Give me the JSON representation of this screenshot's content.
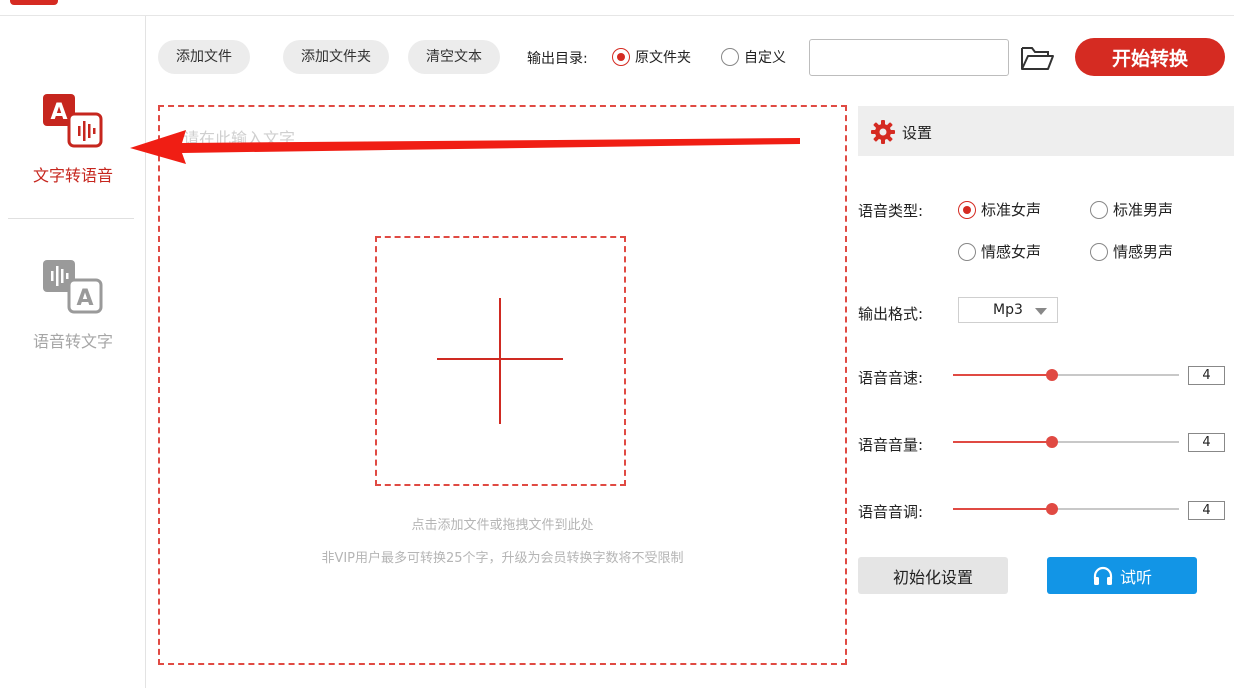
{
  "sidebar": {
    "items": [
      {
        "label": "文字转语音",
        "icon": "text-to-speech-icon",
        "active": true
      },
      {
        "label": "语音转文字",
        "icon": "speech-to-text-icon",
        "active": false
      }
    ]
  },
  "toolbar": {
    "add_file": "添加文件",
    "add_folder": "添加文件夹",
    "clear_text": "清空文本",
    "output_dir_label": "输出目录:",
    "output_options": [
      {
        "label": "原文件夹",
        "selected": true
      },
      {
        "label": "自定义",
        "selected": false
      }
    ],
    "path_value": "",
    "start_label": "开始转换"
  },
  "input_area": {
    "placeholder": "请在此输入文字",
    "hint_primary": "点击添加文件或拖拽文件到此处",
    "hint_secondary": "非VIP用户最多可转换25个字，升级为会员转换字数将不受限制"
  },
  "settings": {
    "title": "设置",
    "voice_type_label": "语音类型:",
    "voice_types": [
      {
        "label": "标准女声",
        "selected": true
      },
      {
        "label": "标准男声",
        "selected": false
      },
      {
        "label": "情感女声",
        "selected": false
      },
      {
        "label": "情感男声",
        "selected": false
      }
    ],
    "format_label": "输出格式:",
    "format_value": "Mp3",
    "speed": {
      "label": "语音音速:",
      "value": "4",
      "level": 0.44
    },
    "volume": {
      "label": "语音音量:",
      "value": "4",
      "level": 0.44
    },
    "pitch": {
      "label": "语音音调:",
      "value": "4",
      "level": 0.44
    },
    "reset_label": "初始化设置",
    "listen_label": "试听"
  },
  "colors": {
    "accent": "#d52b22",
    "blue": "#1295e6"
  }
}
